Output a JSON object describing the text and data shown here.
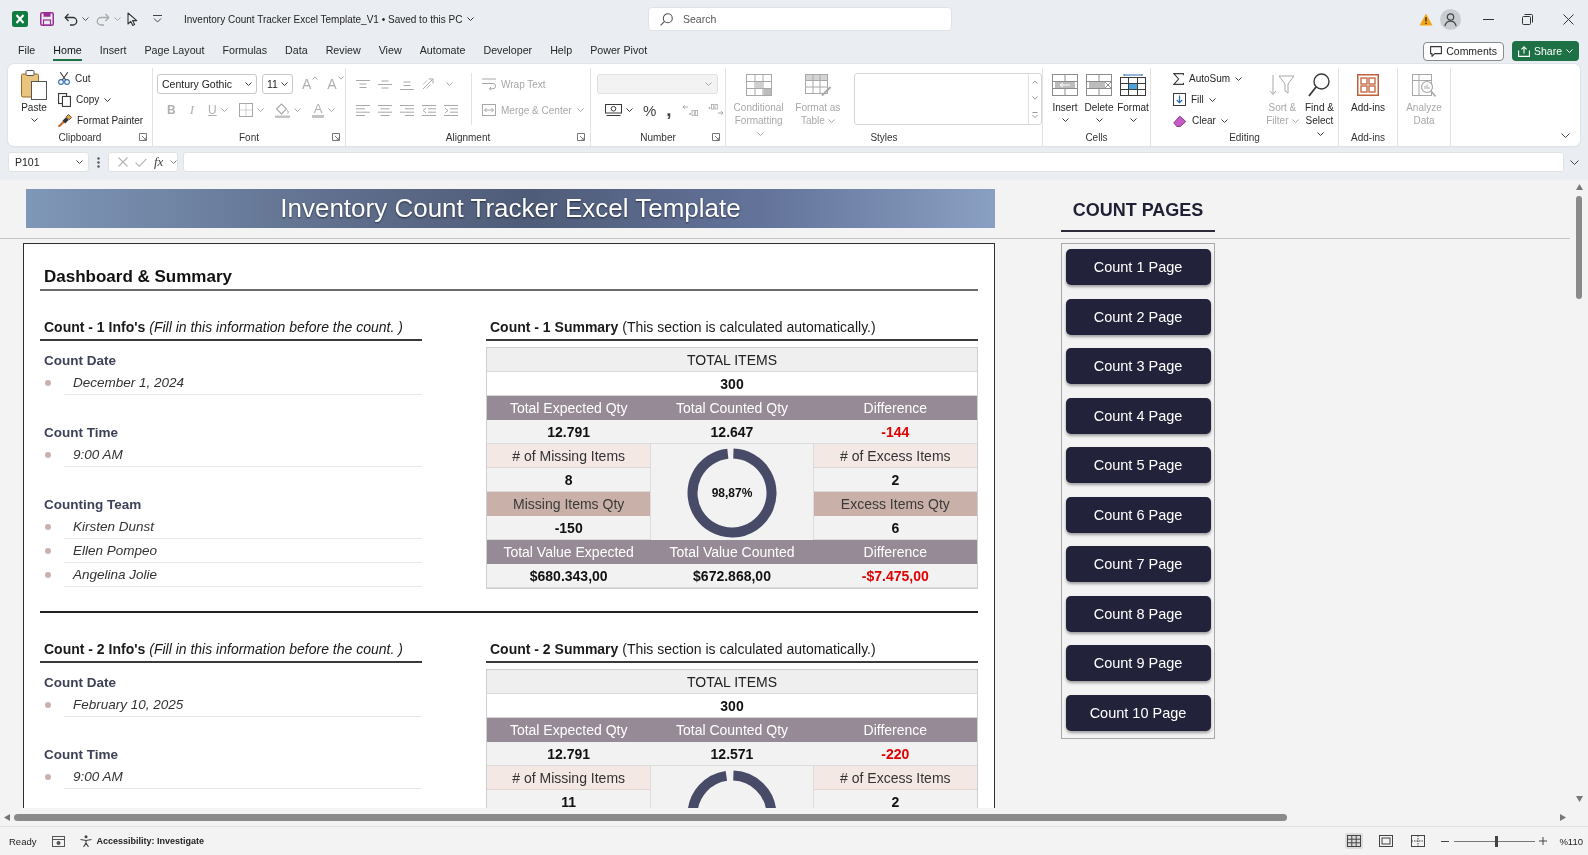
{
  "window": {
    "title": "Inventory Count Tracker Excel Template_V1 • Saved to this PC",
    "search": {
      "placeholder": "Search"
    }
  },
  "quick_access": [
    {
      "disabled": false
    },
    {
      "disabled": false
    },
    {
      "disabled": true
    },
    {
      "disabled": false
    }
  ],
  "menu_tabs": [
    {
      "label": "File",
      "selected": false
    },
    {
      "label": "Home",
      "selected": true
    },
    {
      "label": "Insert",
      "selected": false
    },
    {
      "label": "Page Layout",
      "selected": false
    },
    {
      "label": "Formulas",
      "selected": false
    },
    {
      "label": "Data",
      "selected": false
    },
    {
      "label": "Review",
      "selected": false
    },
    {
      "label": "View",
      "selected": false
    },
    {
      "label": "Automate",
      "selected": false
    },
    {
      "label": "Developer",
      "selected": false
    },
    {
      "label": "Help",
      "selected": false
    },
    {
      "label": "Power Pivot",
      "selected": false
    }
  ],
  "comments_button": "Comments",
  "share_button": "Share",
  "ribbon": {
    "groups": [
      {
        "kind": "clipboard",
        "label": "Clipboard",
        "launcher": true,
        "buttons": [
          {
            "label": "Paste",
            "disabled": false
          },
          {
            "label": "Cut",
            "disabled": false
          },
          {
            "label": "Copy",
            "disabled": false
          },
          {
            "label": "Format Painter",
            "disabled": false
          }
        ]
      },
      {
        "kind": "font",
        "label": "Font",
        "launcher": true,
        "font_name": "Century Gothic",
        "font_size": "11",
        "buttons": [
          {
            "text": "A",
            "disabled": true
          },
          {
            "text": "A",
            "disabled": true
          },
          {
            "text": "B",
            "disabled": true
          },
          {
            "text": "I",
            "disabled": true
          },
          {
            "text": "U",
            "disabled": true
          },
          {
            "disabled": true
          },
          {
            "disabled": true
          },
          {
            "text": "A",
            "disabled": true
          }
        ]
      },
      {
        "kind": "alignment",
        "label": "Alignment",
        "launcher": true,
        "buttons": [
          {
            "disabled": true
          },
          {
            "disabled": true
          },
          {
            "disabled": true
          },
          {
            "disabled": true
          },
          {
            "disabled": true
          },
          {
            "disabled": true
          },
          {
            "disabled": true
          },
          {
            "disabled": true
          },
          {
            "disabled": true
          },
          {
            "label": "Wrap Text",
            "disabled": true
          },
          {
            "label": "Merge & Center",
            "disabled": true
          }
        ]
      },
      {
        "kind": "number",
        "label": "Number",
        "launcher": true,
        "buttons": [
          {
            "disabled": true
          },
          {
            "disabled": false
          },
          {
            "text": "%",
            "disabled": false
          },
          {
            "text": ",",
            "disabled": false
          },
          {
            "disabled": true
          },
          {
            "disabled": true
          }
        ]
      },
      {
        "kind": "styles",
        "label": "Styles",
        "buttons": [
          {
            "label": "Conditional\nFormatting",
            "disabled": true
          },
          {
            "label": "Format as\nTable",
            "disabled": true
          }
        ]
      },
      {
        "kind": "cells",
        "label": "Cells",
        "buttons": [
          {
            "label": "Insert",
            "disabled": false
          },
          {
            "label": "Delete",
            "disabled": false
          },
          {
            "label": "Format",
            "disabled": false
          }
        ]
      },
      {
        "kind": "editing",
        "label": "Editing",
        "buttons": [
          {
            "label": "AutoSum",
            "disabled": false
          },
          {
            "label": "Fill",
            "disabled": false
          },
          {
            "label": "Clear",
            "disabled": false
          },
          {
            "label": "Sort &\nFilter",
            "disabled": true
          },
          {
            "label": "Find &\nSelect",
            "disabled": false
          }
        ]
      },
      {
        "kind": "addins",
        "label": "Add-ins",
        "buttons": [
          {
            "label": "Add-ins",
            "disabled": false
          }
        ]
      },
      {
        "kind": "analysis",
        "buttons": [
          {
            "label": "Analyze\nData",
            "disabled": true
          }
        ]
      }
    ]
  },
  "formula_bar": {
    "name_box": "P101",
    "function_symbol": "fx"
  },
  "sheet": {
    "banner": "Inventory Count Tracker Excel Template",
    "dashboard": {
      "title": "Dashboard & Summary",
      "counts": [
        {
          "info": {
            "heading": "**Count - 1 Info's** *(Fill in this information before the count. )*",
            "fields": [
              {
                "label": "Count Date",
                "values": [
                  "December 1, 2024"
                ]
              },
              {
                "label": "Count Time",
                "values": [
                  "9:00 AM"
                ]
              },
              {
                "label": "Counting Team",
                "values": [
                  "Kirsten Dunst",
                  "Ellen Pompeo",
                  "Angelina Jolie"
                ]
              }
            ]
          },
          "summary": {
            "heading": "**Count - 1 Summary** (This section is calculated automatically.)",
            "total": {
              "label": "TOTAL ITEMS",
              "value": "300"
            },
            "quantities": {
              "headers": [
                "Total Expected Qty",
                "Total Counted Qty",
                "Difference"
              ],
              "values": [
                {
                  "text": "12.791",
                  "warning": false
                },
                {
                  "text": "12.647",
                  "warning": false
                },
                {
                  "text": "-144",
                  "warning": true
                }
              ]
            },
            "missing": [
              {
                "label": "# of Missing Items",
                "value": "8"
              },
              {
                "label": "Missing Items Qty",
                "value": "-150"
              }
            ],
            "excess": [
              {
                "label": "# of Excess Items",
                "value": "2"
              },
              {
                "label": "Excess Items Qty",
                "value": "6"
              }
            ],
            "gauge": {
              "level": 0.9887,
              "label": "98,87%"
            },
            "values": {
              "headers": [
                "Total Value Expected",
                "Total Value Counted",
                "Difference"
              ],
              "values": [
                {
                  "text": "$680.343,00",
                  "warning": false
                },
                {
                  "text": "$672.868,00",
                  "warning": false
                },
                {
                  "text": "-$7.475,00",
                  "warning": true
                }
              ]
            }
          }
        },
        {
          "info": {
            "heading": "**Count - 2 Info's** *(Fill in this information before the count. )*",
            "fields": [
              {
                "label": "Count Date",
                "values": [
                  "February 10, 2025"
                ]
              },
              {
                "label": "Count Time",
                "values": [
                  "9:00 AM"
                ]
              }
            ]
          },
          "summary": {
            "heading": "**Count - 2 Summary** (This section is calculated automatically.)",
            "total": {
              "label": "TOTAL ITEMS",
              "value": "300"
            },
            "quantities": {
              "headers": [
                "Total Expected Qty",
                "Total Counted Qty",
                "Difference"
              ],
              "values": [
                {
                  "text": "12.791",
                  "warning": false
                },
                {
                  "text": "12.571",
                  "warning": false
                },
                {
                  "text": "-220",
                  "warning": true
                }
              ]
            },
            "missing": [
              {
                "label": "# of Missing Items",
                "value": "11"
              }
            ],
            "excess": [
              {
                "label": "# of Excess Items",
                "value": "2"
              }
            ],
            "gauge": {
              "level": 0.9828
            }
          }
        }
      ]
    },
    "count_pages": {
      "title": "COUNT PAGES",
      "buttons": [
        "Count 1 Page",
        "Count 2 Page",
        "Count 3 Page",
        "Count 4 Page",
        "Count 5 Page",
        "Count 6 Page",
        "Count 7 Page",
        "Count 8 Page",
        "Count 9 Page",
        "Count 10 Page"
      ]
    }
  },
  "status_bar": {
    "status": "Ready",
    "accessibility": "Accessibility: Investigate",
    "views": [
      {
        "kind": "normal",
        "selected": true
      },
      {
        "kind": "page_layout",
        "selected": false
      },
      {
        "kind": "page_break",
        "selected": false
      }
    ],
    "zoom": {
      "level": 0.52,
      "reading": "%110"
    }
  }
}
